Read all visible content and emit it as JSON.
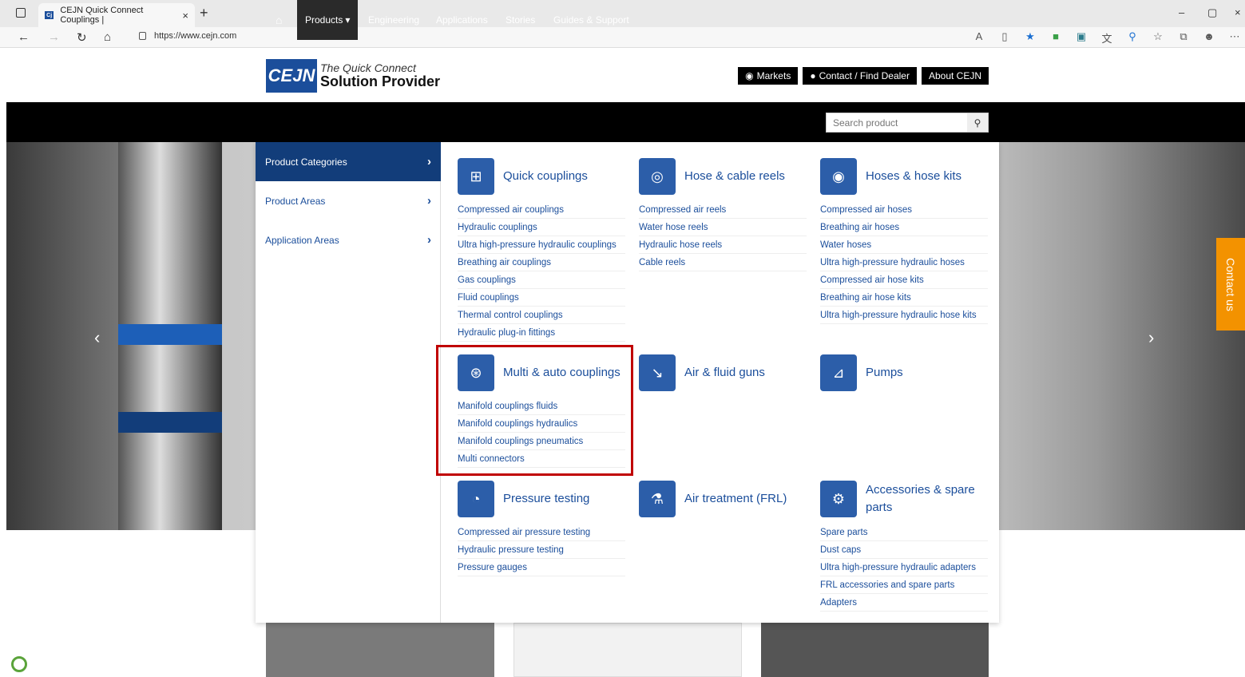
{
  "browser": {
    "tab_title": "CEJN Quick Connect Couplings |",
    "tab_close": "×",
    "new_tab": "+",
    "url": "https://www.cejn.com",
    "window_controls": [
      "–",
      "▢",
      "×"
    ],
    "toolbar_icons": [
      "read-aloud-icon",
      "immersive-reader-icon",
      "favorite-star-icon",
      "extension-icon",
      "screenshot-icon",
      "translate-icon",
      "search-icon",
      "favorites-icon",
      "collections-icon",
      "profile-icon",
      "more-icon"
    ]
  },
  "header": {
    "logo_text": "CEJN",
    "tagline_1": "The Quick Connect",
    "tagline_2": "Solution Provider",
    "buttons": [
      "Markets",
      "Contact / Find Dealer",
      "About CEJN"
    ]
  },
  "nav": {
    "items": [
      "Products",
      "Engineering",
      "Applications",
      "Stories",
      "Guides & Support"
    ],
    "search_placeholder": "Search product"
  },
  "hero": {
    "contact_tab": "Contact us"
  },
  "menu": {
    "left": [
      {
        "label": "Product Categories",
        "active": true
      },
      {
        "label": "Product Areas",
        "active": false
      },
      {
        "label": "Application Areas",
        "active": false
      }
    ],
    "categories": [
      {
        "title": "Quick couplings",
        "icon": "quick-couplings-icon",
        "items": [
          "Compressed air couplings",
          "Hydraulic couplings",
          "Ultra high-pressure hydraulic couplings",
          "Breathing air couplings",
          "Gas couplings",
          "Fluid couplings",
          "Thermal control couplings",
          "Hydraulic plug-in fittings"
        ]
      },
      {
        "title": "Hose & cable reels",
        "icon": "hose-reel-icon",
        "items": [
          "Compressed air reels",
          "Water hose reels",
          "Hydraulic hose reels",
          "Cable reels"
        ]
      },
      {
        "title": "Hoses & hose kits",
        "icon": "hose-icon",
        "items": [
          "Compressed air hoses",
          "Breathing air hoses",
          "Water hoses",
          "Ultra high-pressure hydraulic hoses",
          "Compressed air hose kits",
          "Breathing air hose kits",
          "Ultra high-pressure hydraulic hose kits"
        ]
      },
      {
        "title": "Multi & auto couplings",
        "icon": "multi-couplings-icon",
        "items": [
          "Manifold couplings fluids",
          "Manifold couplings hydraulics",
          "Manifold couplings pneumatics",
          "Multi connectors"
        ]
      },
      {
        "title": "Air & fluid guns",
        "icon": "air-gun-icon",
        "items": []
      },
      {
        "title": "Pumps",
        "icon": "pump-icon",
        "items": []
      },
      {
        "title": "Pressure testing",
        "icon": "pressure-gauge-icon",
        "items": [
          "Compressed air pressure testing",
          "Hydraulic pressure testing",
          "Pressure gauges"
        ]
      },
      {
        "title": "Air treatment (FRL)",
        "icon": "air-treatment-icon",
        "items": []
      },
      {
        "title": "Accessories & spare parts",
        "icon": "accessories-icon",
        "items": [
          "Spare parts",
          "Dust caps",
          "Ultra high-pressure hydraulic adapters",
          "FRL accessories and spare parts",
          "Adapters"
        ]
      }
    ]
  }
}
